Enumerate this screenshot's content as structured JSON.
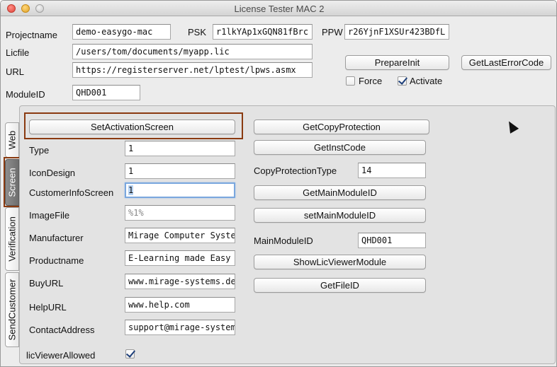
{
  "window": {
    "title": "License Tester MAC 2"
  },
  "top": {
    "projectname": {
      "label": "Projectname",
      "value": "demo-easygo-mac"
    },
    "psk": {
      "label": "PSK",
      "value": "r1lkYAp1xGQN81fBrc"
    },
    "ppw": {
      "label": "PPW",
      "value": "r26YjnF1XSUr423BDfL"
    },
    "licfile": {
      "label": "Licfile",
      "value": "/users/tom/documents/myapp.lic"
    },
    "url": {
      "label": "URL",
      "value": "https://registerserver.net/lptest/lpws.asmx"
    },
    "moduleid": {
      "label": "ModuleID",
      "value": "QHD001"
    },
    "prepare_init": "PrepareInit",
    "get_last_error": "GetLastErrorCode",
    "force": {
      "label": "Force",
      "checked": false
    },
    "activate": {
      "label": "Activate",
      "checked": true
    }
  },
  "tabs": [
    "Web",
    "Screen",
    "Verification",
    "SendCustomer"
  ],
  "active_tab": "Screen",
  "screen": {
    "set_activation_screen": "SetActivationScreen",
    "fields": {
      "type": {
        "label": "Type",
        "value": "1"
      },
      "icon_design": {
        "label": "IconDesign",
        "value": "1"
      },
      "customer_info_screen": {
        "label": "CustomerInfoScreen",
        "value": "1"
      },
      "image_file": {
        "label": "ImageFile",
        "placeholder": "%1%"
      },
      "manufacturer": {
        "label": "Manufacturer",
        "value": "Mirage Computer Systems"
      },
      "productname": {
        "label": "Productname",
        "value": "E-Learning made Easy"
      },
      "buy_url": {
        "label": "BuyURL",
        "value": "www.mirage-systems.de"
      },
      "help_url": {
        "label": "HelpURL",
        "value": "www.help.com"
      },
      "contact_address": {
        "label": "ContactAddress",
        "value": "support@mirage-systems.de"
      }
    },
    "lic_viewer_allowed": {
      "label": "licViewerAllowed",
      "checked": true
    },
    "get_copy_protection": "GetCopyProtection",
    "get_inst_code": "GetInstCode",
    "copy_protection_type": {
      "label": "CopyProtectionType",
      "value": "14"
    },
    "get_main_module_id": "GetMainModuleID",
    "set_main_module_id": "setMainModuleID",
    "main_module_id": {
      "label": "MainModuleID",
      "value": "QHD001"
    },
    "show_lic_viewer_module": "ShowLicViewerModule",
    "get_file_id": "GetFileID"
  },
  "colors": {
    "highlight": "#8a3a10",
    "focus_ring": "#7aa7de",
    "active_tab": "#7a7a7a"
  }
}
